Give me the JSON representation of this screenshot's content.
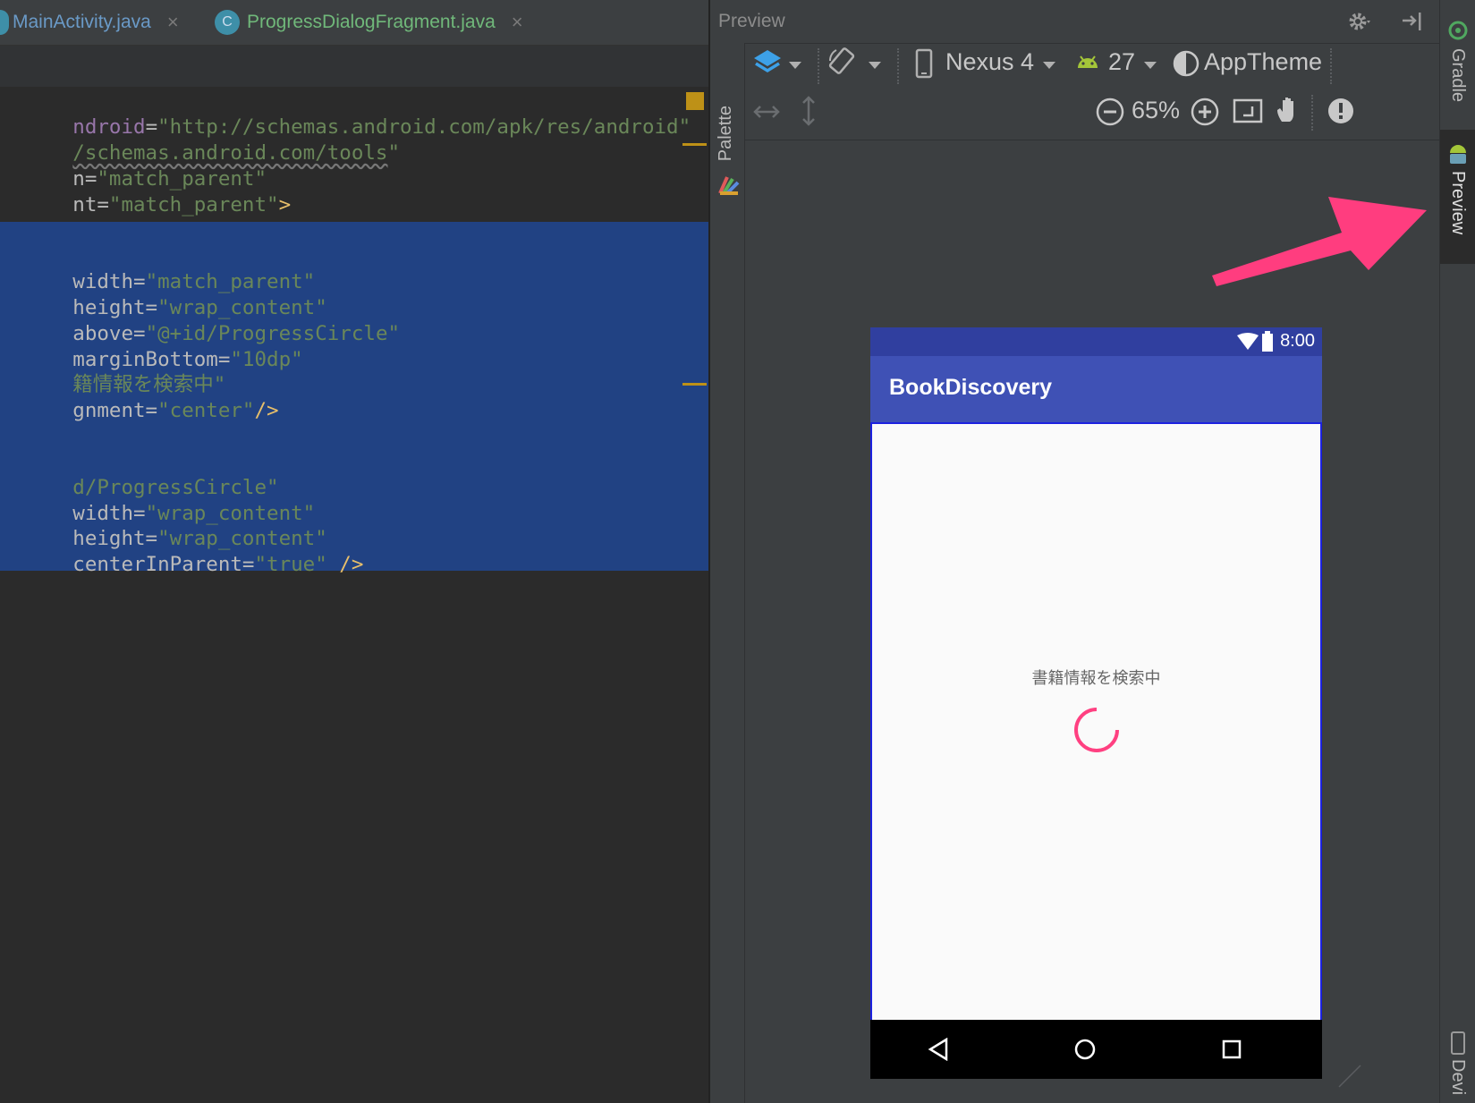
{
  "tabs": [
    {
      "label": "MainActivity.java"
    },
    {
      "label": "ProgressDialogFragment.java",
      "badge": "C"
    }
  ],
  "code_lines": {
    "l1": {
      "a": "ndroid",
      "eq": "=",
      "v": "\"http://schemas.android.com/apk/res/android\""
    },
    "l2": {
      "v": "/schemas.android.com/tools",
      "q": "\""
    },
    "l3": {
      "a": "n=",
      "v": "\"match_parent\""
    },
    "l4": {
      "a": "nt=",
      "v": "\"match_parent\"",
      "t": ">"
    },
    "l5": {
      "a": "width=",
      "v": "\"match_parent\""
    },
    "l6": {
      "a": "height=",
      "v": "\"wrap_content\""
    },
    "l7": {
      "a": "above=",
      "v": "\"@+id/ProgressCircle\""
    },
    "l8": {
      "a": "marginBottom=",
      "v": "\"10dp\""
    },
    "l9": {
      "v": "籍情報を検索中\""
    },
    "l10": {
      "a": "gnment=",
      "v": "\"center\"",
      "t": "/>"
    },
    "l11": {
      "v": "d/ProgressCircle\""
    },
    "l12": {
      "a": "width=",
      "v": "\"wrap_content\""
    },
    "l13": {
      "a": "height=",
      "v": "\"wrap_content\""
    },
    "l14": {
      "a": "centerInParent=",
      "v": "\"true\"",
      "t": " />"
    }
  },
  "preview": {
    "title": "Preview",
    "palette_label": "Palette",
    "device": "Nexus 4",
    "api_level": "27",
    "theme": "AppTheme",
    "zoom": "65%"
  },
  "phone": {
    "time": "8:00",
    "app_title": "BookDiscovery",
    "message": "書籍情報を検索中",
    "spinner_color": "#ff4081",
    "primary_color": "#3f51b5",
    "primary_dark_color": "#303f9f"
  },
  "sidebar": {
    "gradle": "Gradle",
    "preview": "Preview",
    "devices": "Devi"
  },
  "colors": {
    "accent_arrow": "#ff3d7f"
  }
}
